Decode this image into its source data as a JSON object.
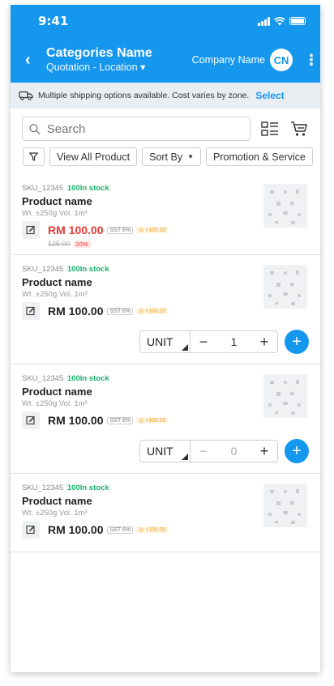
{
  "status_bar": {
    "time": "9:41"
  },
  "header": {
    "title": "Categories Name",
    "subtitle": "Quotation - Location ▾",
    "company": "Company Name",
    "avatar_initials": "CN",
    "accent_color": "#1597ee"
  },
  "notice": {
    "text": "Multiple shipping options available. Cost varies by zone.",
    "link": "Select"
  },
  "search": {
    "placeholder": "Search"
  },
  "filters": {
    "view_all": "View All Product",
    "sort_by": "Sort By",
    "promotion": "Promotion & Service"
  },
  "products": [
    {
      "sku": "SKU_12345",
      "stock": "100In stock",
      "name": "Product name",
      "spec": "Wt. ±250g  Vol. 1m³",
      "price": "RM 100.00",
      "sst": "SST 6%",
      "coin": "◎ +100.00",
      "old_price": "125.00",
      "discount": "20%"
    },
    {
      "sku": "SKU_12345",
      "stock": "100In stock",
      "name": "Product name",
      "spec": "Wt. ±250g  Vol. 1m³",
      "price": "RM 100.00",
      "sst": "SST 6%",
      "coin": "◎ +100.00",
      "unit": "UNIT",
      "qty": "1"
    },
    {
      "sku": "SKU_12345",
      "stock": "100In stock",
      "name": "Product name",
      "spec": "Wt. ±250g  Vol. 1m³",
      "price": "RM 100.00",
      "sst": "SST 6%",
      "coin": "◎ +100.00",
      "unit": "UNIT",
      "qty": "0"
    },
    {
      "sku": "SKU_12345",
      "stock": "100In stock",
      "name": "Product name",
      "spec": "Wt. ±250g  Vol. 1m³",
      "price": "RM 100.00",
      "sst": "SST 6%",
      "coin": "◎ +100.00"
    }
  ],
  "icons": {
    "back": "chevron-left-icon",
    "menu": "kebab-menu-icon",
    "truck": "truck-icon",
    "search": "search-icon",
    "layout": "layout-toggle-icon",
    "cart": "cart-icon",
    "filter": "filter-icon",
    "edit": "edit-icon"
  }
}
